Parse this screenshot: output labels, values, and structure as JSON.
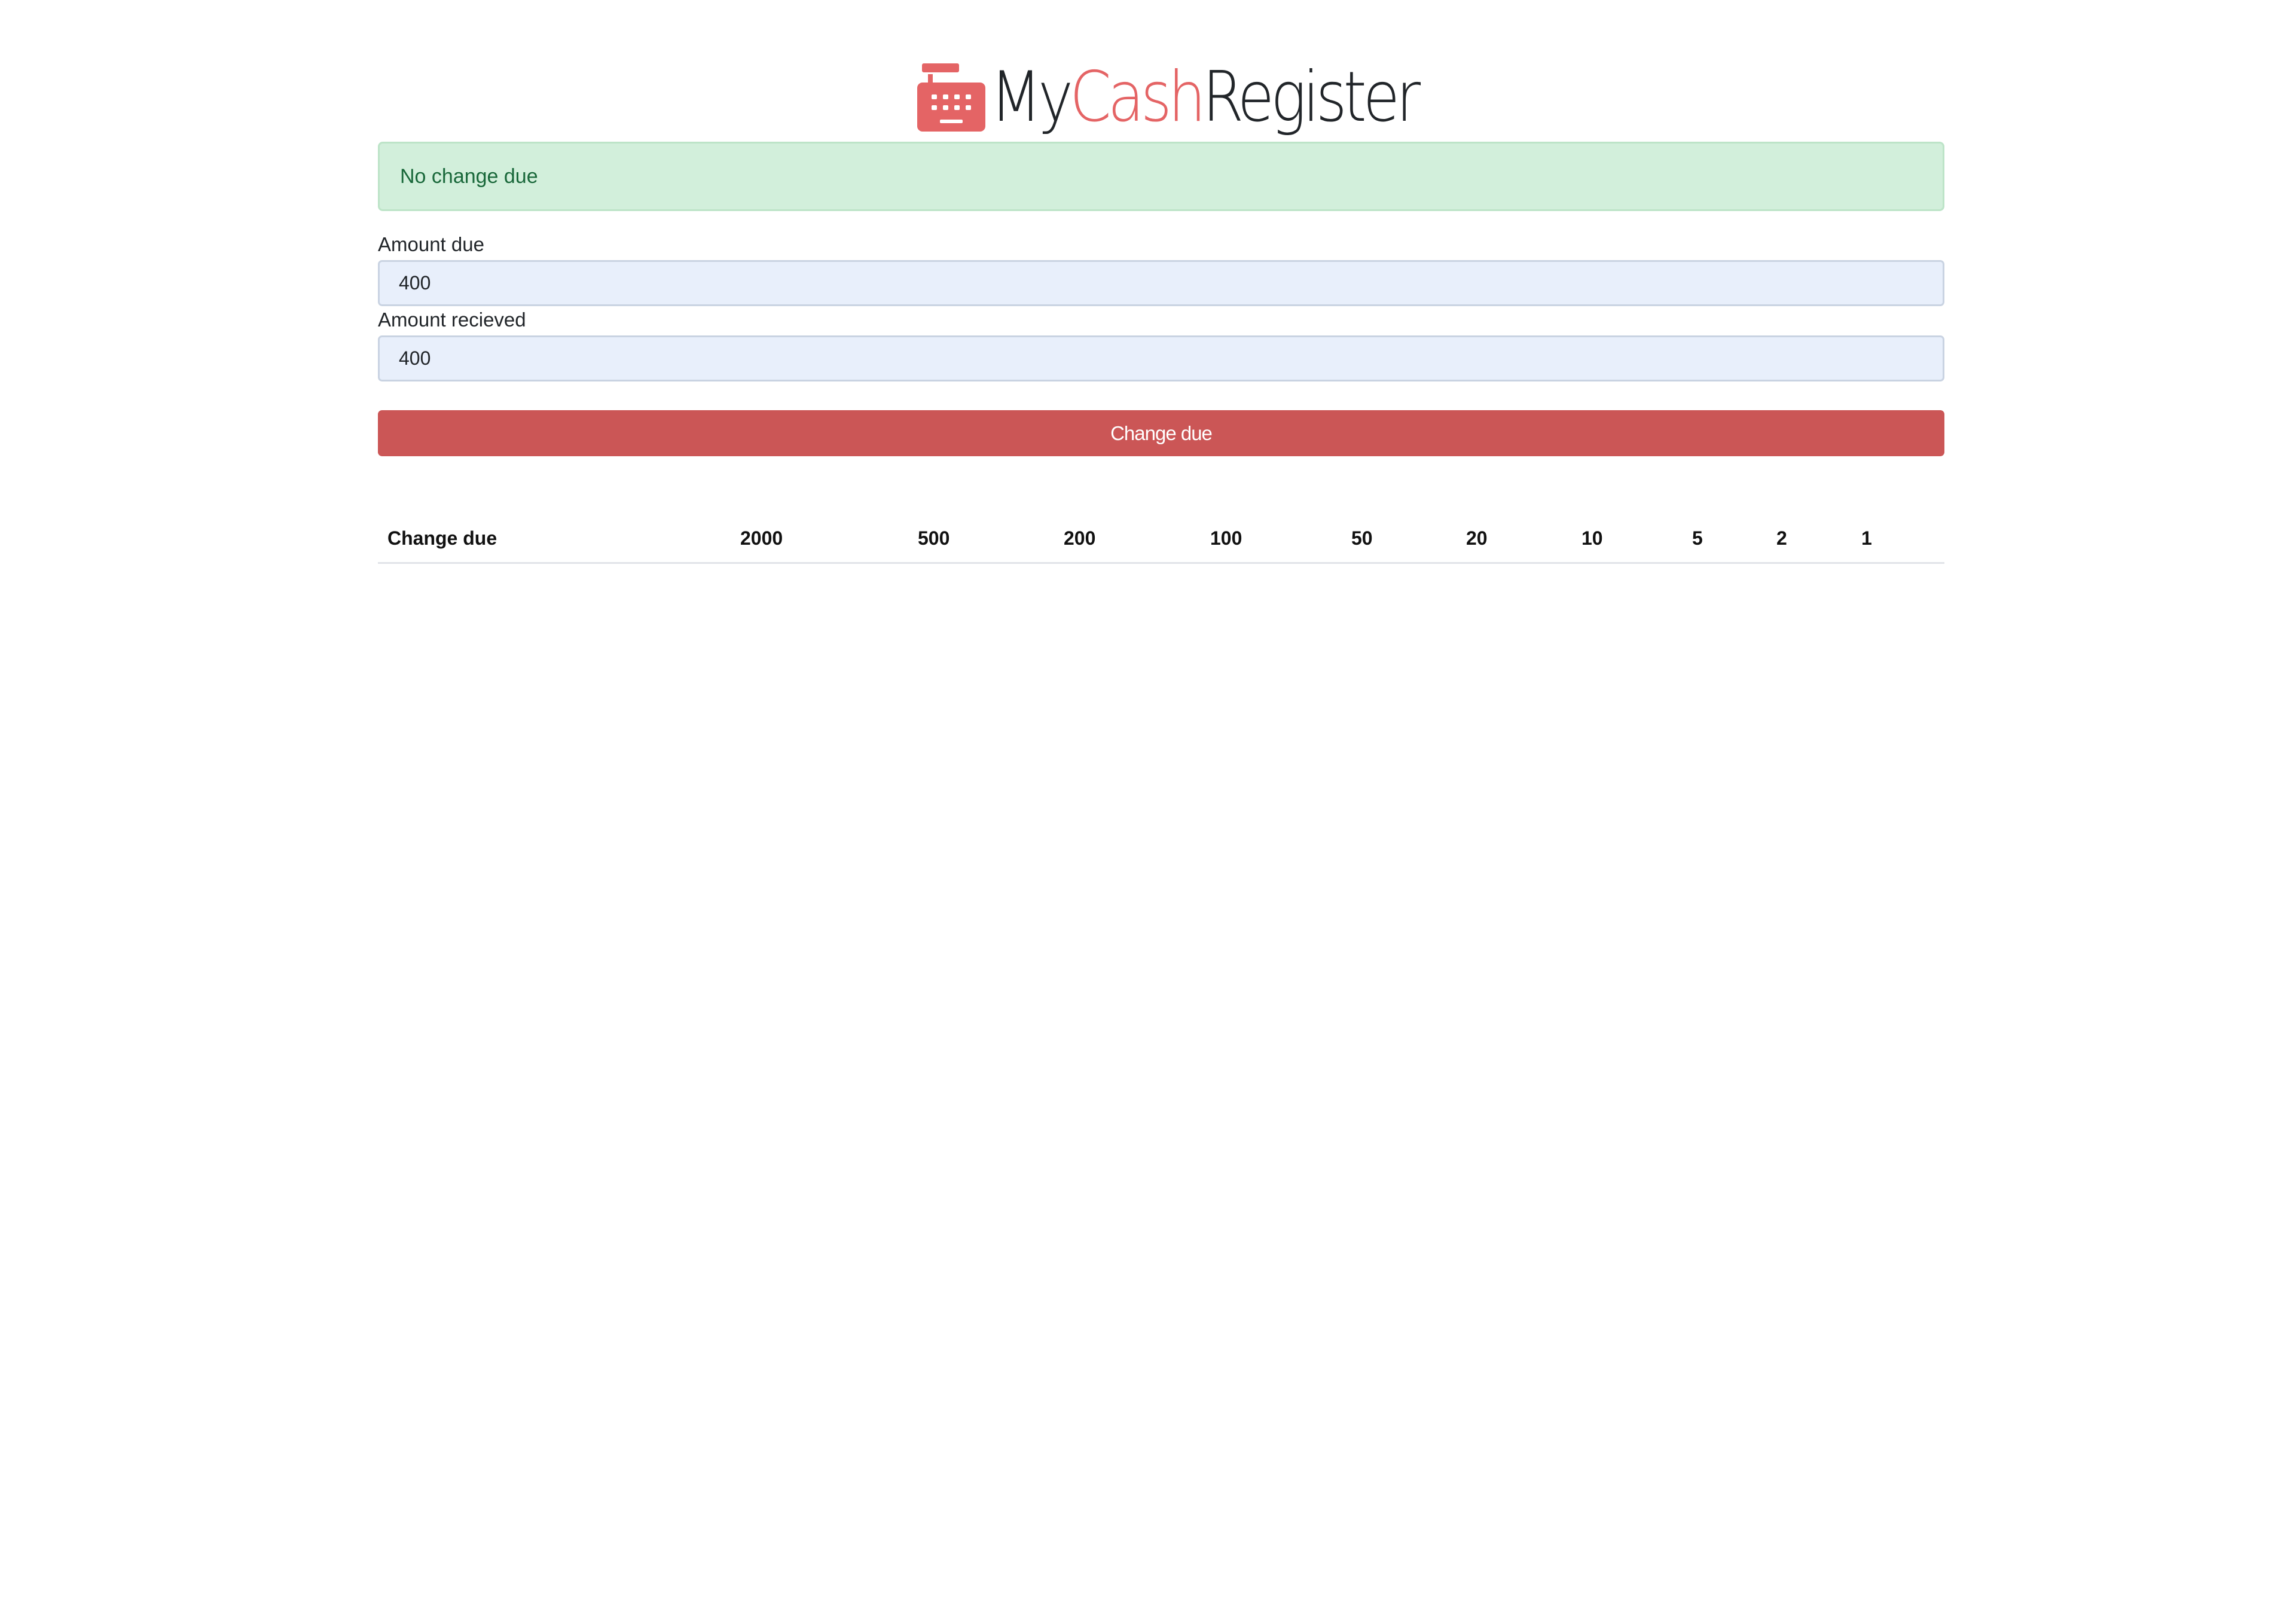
{
  "header": {
    "logo": {
      "icon": "cash-register-icon",
      "text_my": "My",
      "text_cash": "Cash",
      "text_register": "Register"
    }
  },
  "alert": {
    "message": "No change due",
    "status": "success"
  },
  "form": {
    "amount_due": {
      "label": "Amount due",
      "value": "400"
    },
    "amount_received": {
      "label": "Amount recieved",
      "value": "400"
    },
    "submit_label": "Change due"
  },
  "table": {
    "headers": [
      "Change due",
      "2000",
      "500",
      "200",
      "100",
      "50",
      "20",
      "10",
      "5",
      "2",
      "1"
    ],
    "rows": []
  },
  "colors": {
    "accent": "#e46465",
    "button": "#cb5656",
    "alert_bg": "#d2efdb",
    "alert_text": "#19683a",
    "input_bg": "#e8effb"
  }
}
